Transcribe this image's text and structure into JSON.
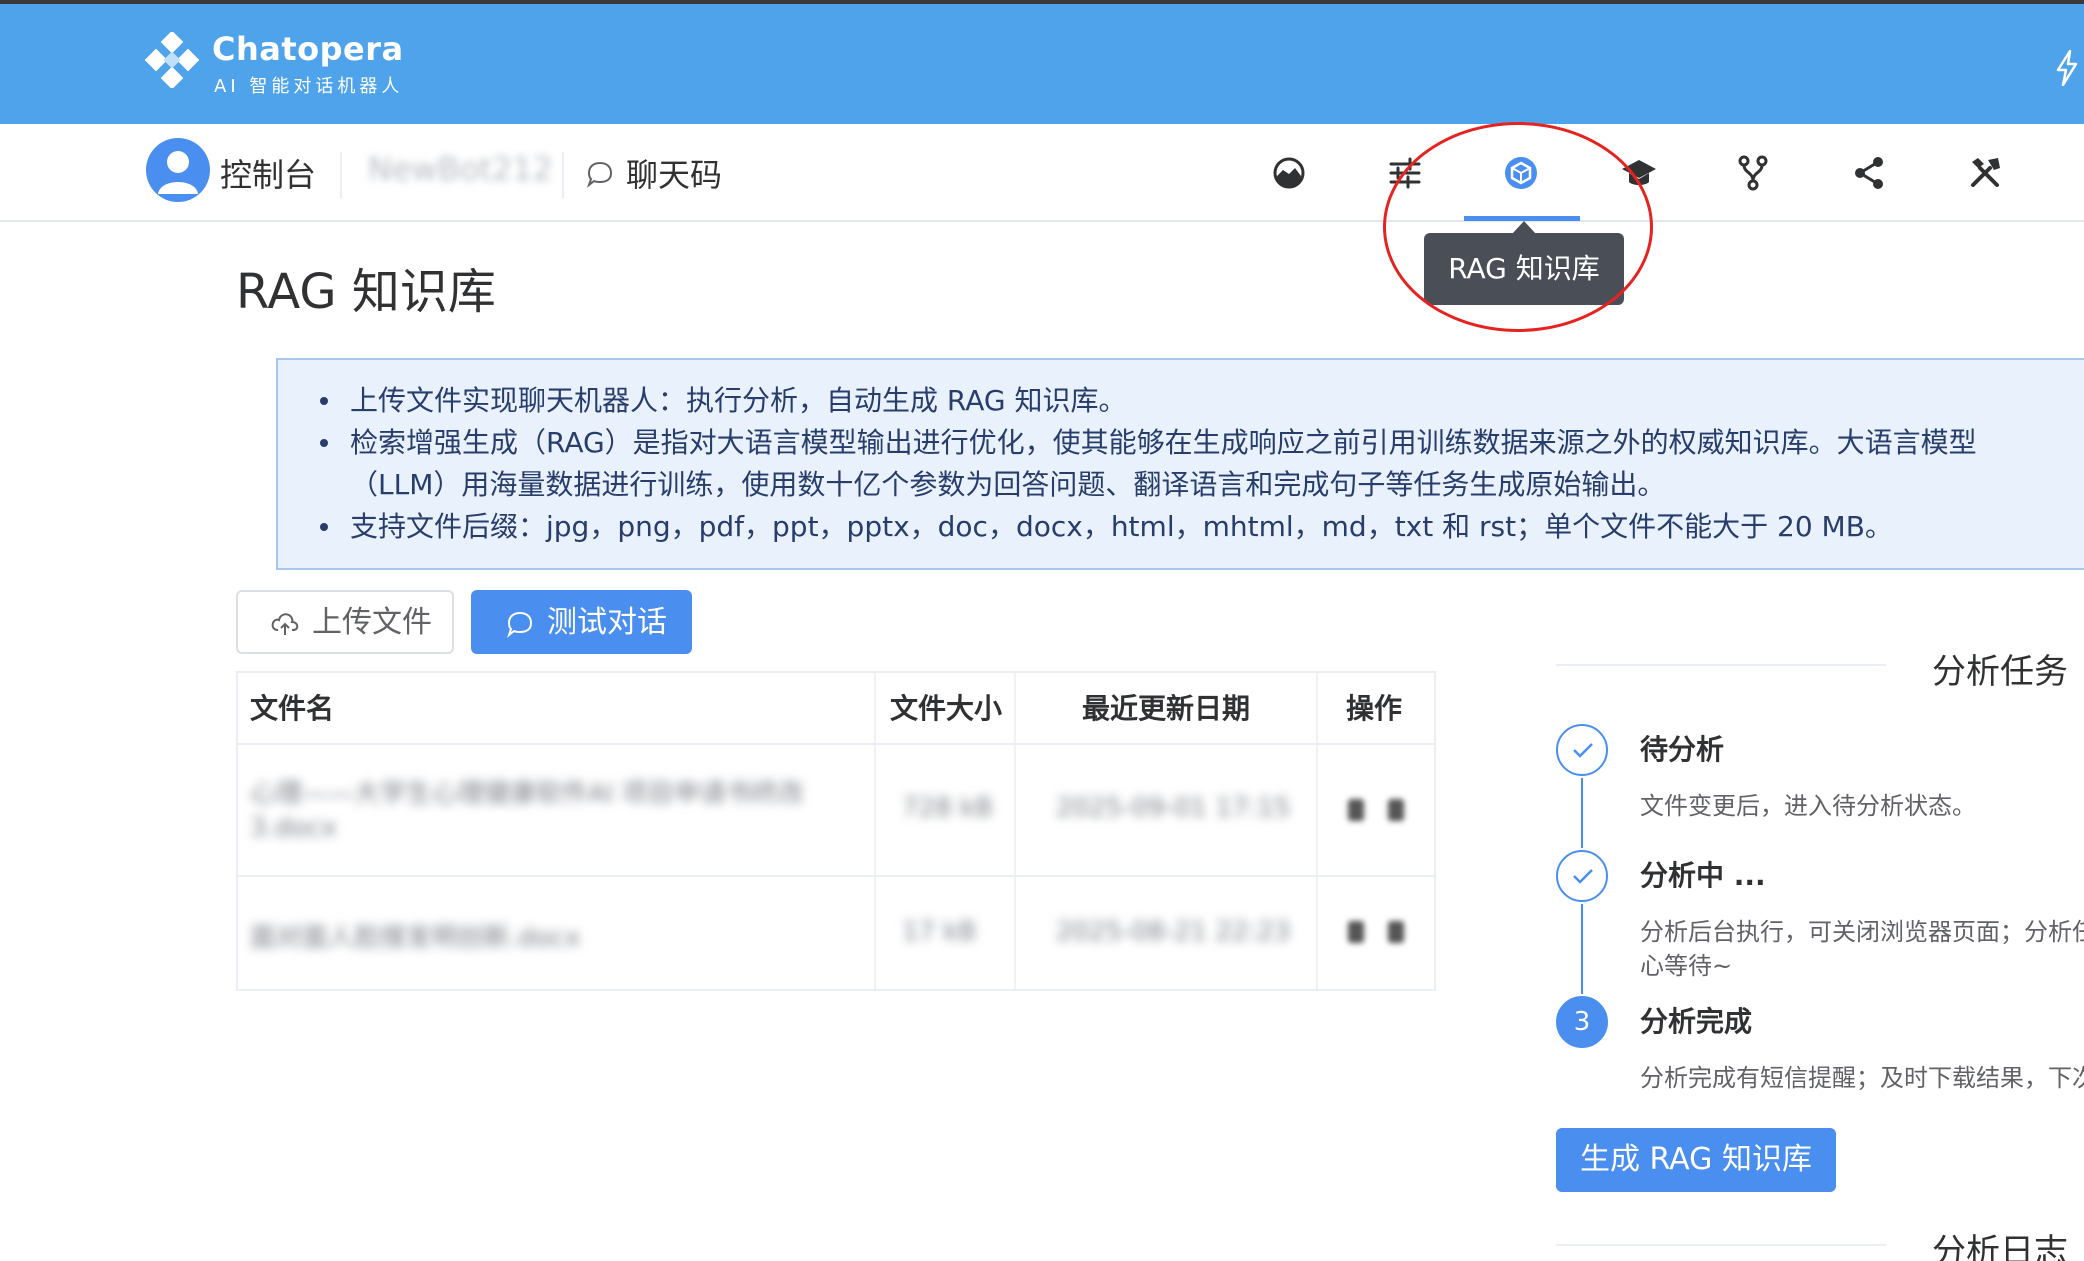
{
  "brand": {
    "name": "Chatopera",
    "subtitle": "AI 智能对话机器人"
  },
  "nav": {
    "console_label": "控制台",
    "bot_name": "NewBot212",
    "chat_code_label": "聊天码",
    "icons": [
      "dashboard-icon",
      "sliders-icon",
      "rag-knowledge-icon",
      "graduation-cap-icon",
      "branch-icon",
      "share-icon",
      "tools-icon"
    ],
    "active_icon": "rag-knowledge-icon",
    "tooltip": "RAG 知识库"
  },
  "page": {
    "title": "RAG 知识库",
    "info": [
      "上传文件实现聊天机器人：执行分析，自动生成 RAG 知识库。",
      "检索增强生成（RAG）是指对大语言模型输出进行优化，使其能够在生成响应之前引用训练数据来源之外的权威知识库。大语言模型（LLM）用海量数据进行训练，使用数十亿个参数为回答问题、翻译语言和完成句子等任务生成原始输出。",
      "支持文件后缀：jpg，png，pdf，ppt，pptx，doc，docx，html，mhtml，md，txt 和 rst；单个文件不能大于 20 MB。"
    ],
    "upload_button": "上传文件",
    "test_button": "测试对话"
  },
  "table": {
    "headers": [
      "文件名",
      "文件大小",
      "最近更新日期",
      "操作"
    ],
    "rows": [
      {
        "name_line1": "心理——大学生心理健康软件AI 项目申请书终改",
        "name_line2": "3.docx",
        "size": "728 kB",
        "date": "2025-09-01 17:15"
      },
      {
        "name_line1": "面对面人脸搜发明创新.docx",
        "name_line2": "",
        "size": "17 kB",
        "date": "2025-08-21 22:23"
      }
    ]
  },
  "analysis": {
    "title": "分析任务",
    "steps": [
      {
        "title": "待分析",
        "desc": "文件变更后，进入待分析状态。"
      },
      {
        "title": "分析中 ...",
        "desc": "分析后台执行，可关闭浏览器页面；分析任",
        "desc2": "心等待~"
      },
      {
        "number": "3",
        "title": "分析完成",
        "desc": "分析完成有短信提醒；及时下载结果，下次"
      }
    ],
    "generate_button": "生成 RAG 知识库",
    "log_title": "分析日志"
  },
  "colors": {
    "header": "#4fa3ea",
    "primary": "#4a8ff0",
    "tooltip": "#4a4e57",
    "annotation": "#e52421"
  }
}
